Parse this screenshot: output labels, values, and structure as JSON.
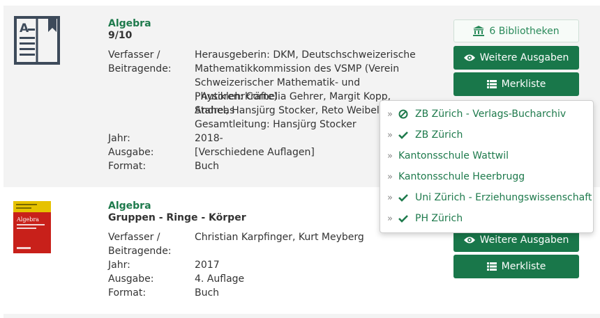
{
  "results": [
    {
      "title": "Algebra",
      "subtitle": "9/10",
      "fields": [
        {
          "label": "Verfasser /",
          "value": "Herausgeberin: DKM, Deutschschweizerische"
        },
        {
          "label": "Beitragende:",
          "value": "Mathematikkommission des VSMP (Verein"
        },
        {
          "label": "",
          "value": "Schweizerischer Mathematik- und Physiklehrkräfte)"
        },
        {
          "label": "",
          "value": "; Autoren: Cornelia Gehrer, Margit Kopp, Andreas"
        },
        {
          "label": "",
          "value": "Stahel, Hansjürg Stocker, Reto Weibel ;"
        },
        {
          "label": "",
          "value": "Gesamtleitung: Hansjürg Stocker"
        },
        {
          "label": "Jahr:",
          "value": "2018-"
        },
        {
          "label": "Ausgabe:",
          "value": "[Verschiedene Auflagen]"
        },
        {
          "label": "Format:",
          "value": "Buch"
        }
      ],
      "buttons": {
        "libraries": "6 Bibliotheken",
        "editions": "Weitere Ausgaben",
        "watchlist": "Merkliste"
      }
    },
    {
      "title": "Algebra",
      "subtitle": "Gruppen - Ringe - Körper",
      "cover_text": "Algebra",
      "fields": [
        {
          "label": "Verfasser /",
          "value": "Christian Karpfinger, Kurt Meyberg"
        },
        {
          "label": "Beitragende:",
          "value": ""
        },
        {
          "label": "Jahr:",
          "value": "2017"
        },
        {
          "label": "Ausgabe:",
          "value": "4. Auflage"
        },
        {
          "label": "Format:",
          "value": "Buch"
        }
      ],
      "buttons": {
        "editions": "Weitere Ausgaben",
        "watchlist": "Merkliste"
      }
    }
  ],
  "library_dropdown": [
    {
      "name": "ZB Zürich - Verlags-Bucharchiv",
      "status": "unavailable"
    },
    {
      "name": "ZB Zürich",
      "status": "available"
    },
    {
      "name": "Kantonsschule Wattwil",
      "status": "none"
    },
    {
      "name": "Kantonsschule Heerbrugg",
      "status": "none"
    },
    {
      "name": "Uni Zürich - Erziehungswissenschaft",
      "status": "available"
    },
    {
      "name": "PH Zürich",
      "status": "available"
    }
  ],
  "colors": {
    "accent": "#19774a",
    "link": "#1e7a4c",
    "row_bg": "#f3f3f3"
  }
}
